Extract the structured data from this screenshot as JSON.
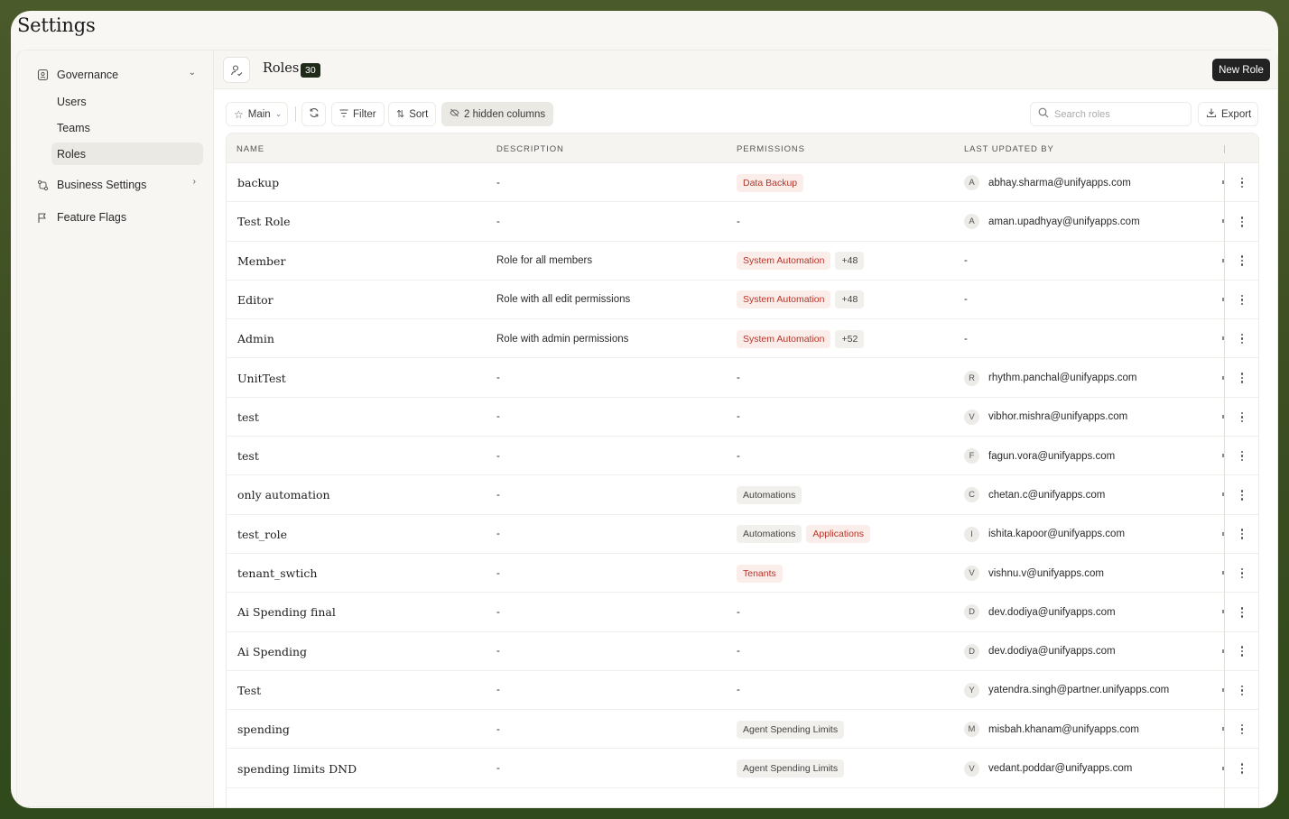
{
  "app": {
    "title": "Settings"
  },
  "sidebar": {
    "groups": [
      {
        "label": "Governance",
        "icon": "badge-icon",
        "expanded": true,
        "items": [
          {
            "label": "Users"
          },
          {
            "label": "Teams"
          },
          {
            "label": "Roles",
            "active": true
          }
        ]
      },
      {
        "label": "Business Settings",
        "icon": "workflow-icon",
        "expanded": false
      },
      {
        "label": "Feature Flags",
        "icon": "flag-icon",
        "expanded": false
      }
    ]
  },
  "header": {
    "title": "Roles",
    "count": "30",
    "new_button": "New Role",
    "icon": "user-check-icon"
  },
  "toolbar": {
    "view_label": "Main",
    "filter_label": "Filter",
    "sort_label": "Sort",
    "hidden_columns_label": "2 hidden columns",
    "search_placeholder": "Search roles",
    "export_label": "Export"
  },
  "table": {
    "columns": [
      "NAME",
      "DESCRIPTION",
      "PERMISSIONS",
      "LAST UPDATED BY"
    ],
    "rows": [
      {
        "name": "backup",
        "description": "-",
        "permissions": [
          {
            "label": "Data Backup",
            "style": "red"
          }
        ],
        "user_initial": "A",
        "user": "abhay.sharma@unifyapps.com"
      },
      {
        "name": "Test Role",
        "description": "-",
        "permissions_text": "-",
        "user_initial": "A",
        "user": "aman.upadhyay@unifyapps.com"
      },
      {
        "name": "Member",
        "description": "Role for all members",
        "permissions": [
          {
            "label": "System Automation",
            "style": "red"
          },
          {
            "label": "+48",
            "style": "gray"
          }
        ],
        "user": "-"
      },
      {
        "name": "Editor",
        "description": "Role with all edit permissions",
        "permissions": [
          {
            "label": "System Automation",
            "style": "red"
          },
          {
            "label": "+48",
            "style": "gray"
          }
        ],
        "user": "-"
      },
      {
        "name": "Admin",
        "description": "Role with admin permissions",
        "permissions": [
          {
            "label": "System Automation",
            "style": "red"
          },
          {
            "label": "+52",
            "style": "gray"
          }
        ],
        "user": "-"
      },
      {
        "name": "UnitTest",
        "description": "-",
        "permissions_text": "-",
        "user_initial": "R",
        "user": "rhythm.panchal@unifyapps.com"
      },
      {
        "name": "test",
        "description": "-",
        "permissions_text": "-",
        "user_initial": "V",
        "user": "vibhor.mishra@unifyapps.com"
      },
      {
        "name": "test",
        "description": "-",
        "permissions_text": "-",
        "user_initial": "F",
        "user": "fagun.vora@unifyapps.com"
      },
      {
        "name": "only automation",
        "description": "-",
        "permissions": [
          {
            "label": "Automations",
            "style": "gray"
          }
        ],
        "user_initial": "C",
        "user": "chetan.c@unifyapps.com"
      },
      {
        "name": "test_role",
        "description": "-",
        "permissions": [
          {
            "label": "Automations",
            "style": "gray"
          },
          {
            "label": "Applications",
            "style": "red"
          }
        ],
        "user_initial": "I",
        "user": "ishita.kapoor@unifyapps.com"
      },
      {
        "name": "tenant_swtich",
        "description": "-",
        "permissions": [
          {
            "label": "Tenants",
            "style": "red"
          }
        ],
        "user_initial": "V",
        "user": "vishnu.v@unifyapps.com"
      },
      {
        "name": "Ai Spending final",
        "description": "-",
        "permissions_text": "-",
        "user_initial": "D",
        "user": "dev.dodiya@unifyapps.com"
      },
      {
        "name": "Ai Spending",
        "description": "-",
        "permissions_text": "-",
        "user_initial": "D",
        "user": "dev.dodiya@unifyapps.com"
      },
      {
        "name": "Test",
        "description": "-",
        "permissions_text": "-",
        "user_initial": "Y",
        "user": "yatendra.singh@partner.unifyapps.com"
      },
      {
        "name": "spending",
        "description": "-",
        "permissions": [
          {
            "label": "Agent Spending Limits",
            "style": "gray"
          }
        ],
        "user_initial": "M",
        "user": "misbah.khanam@unifyapps.com"
      },
      {
        "name": "spending limits DND",
        "description": "-",
        "permissions": [
          {
            "label": "Agent Spending Limits",
            "style": "gray"
          }
        ],
        "user_initial": "V",
        "user": "vedant.poddar@unifyapps.com"
      }
    ]
  },
  "colors": {
    "accent_dark": "#222222",
    "tag_red_bg": "#fbeeea",
    "tag_red_text": "#b5352a",
    "tag_gray_bg": "#f1f0ec"
  }
}
